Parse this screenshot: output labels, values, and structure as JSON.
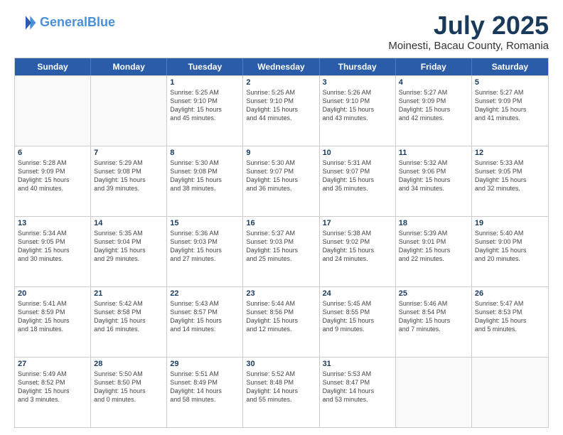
{
  "header": {
    "logo_line1": "General",
    "logo_line2": "Blue",
    "month": "July 2025",
    "location": "Moinesti, Bacau County, Romania"
  },
  "weekdays": [
    "Sunday",
    "Monday",
    "Tuesday",
    "Wednesday",
    "Thursday",
    "Friday",
    "Saturday"
  ],
  "rows": [
    [
      {
        "day": "",
        "info": ""
      },
      {
        "day": "",
        "info": ""
      },
      {
        "day": "1",
        "info": "Sunrise: 5:25 AM\nSunset: 9:10 PM\nDaylight: 15 hours\nand 45 minutes."
      },
      {
        "day": "2",
        "info": "Sunrise: 5:25 AM\nSunset: 9:10 PM\nDaylight: 15 hours\nand 44 minutes."
      },
      {
        "day": "3",
        "info": "Sunrise: 5:26 AM\nSunset: 9:10 PM\nDaylight: 15 hours\nand 43 minutes."
      },
      {
        "day": "4",
        "info": "Sunrise: 5:27 AM\nSunset: 9:09 PM\nDaylight: 15 hours\nand 42 minutes."
      },
      {
        "day": "5",
        "info": "Sunrise: 5:27 AM\nSunset: 9:09 PM\nDaylight: 15 hours\nand 41 minutes."
      }
    ],
    [
      {
        "day": "6",
        "info": "Sunrise: 5:28 AM\nSunset: 9:09 PM\nDaylight: 15 hours\nand 40 minutes."
      },
      {
        "day": "7",
        "info": "Sunrise: 5:29 AM\nSunset: 9:08 PM\nDaylight: 15 hours\nand 39 minutes."
      },
      {
        "day": "8",
        "info": "Sunrise: 5:30 AM\nSunset: 9:08 PM\nDaylight: 15 hours\nand 38 minutes."
      },
      {
        "day": "9",
        "info": "Sunrise: 5:30 AM\nSunset: 9:07 PM\nDaylight: 15 hours\nand 36 minutes."
      },
      {
        "day": "10",
        "info": "Sunrise: 5:31 AM\nSunset: 9:07 PM\nDaylight: 15 hours\nand 35 minutes."
      },
      {
        "day": "11",
        "info": "Sunrise: 5:32 AM\nSunset: 9:06 PM\nDaylight: 15 hours\nand 34 minutes."
      },
      {
        "day": "12",
        "info": "Sunrise: 5:33 AM\nSunset: 9:05 PM\nDaylight: 15 hours\nand 32 minutes."
      }
    ],
    [
      {
        "day": "13",
        "info": "Sunrise: 5:34 AM\nSunset: 9:05 PM\nDaylight: 15 hours\nand 30 minutes."
      },
      {
        "day": "14",
        "info": "Sunrise: 5:35 AM\nSunset: 9:04 PM\nDaylight: 15 hours\nand 29 minutes."
      },
      {
        "day": "15",
        "info": "Sunrise: 5:36 AM\nSunset: 9:03 PM\nDaylight: 15 hours\nand 27 minutes."
      },
      {
        "day": "16",
        "info": "Sunrise: 5:37 AM\nSunset: 9:03 PM\nDaylight: 15 hours\nand 25 minutes."
      },
      {
        "day": "17",
        "info": "Sunrise: 5:38 AM\nSunset: 9:02 PM\nDaylight: 15 hours\nand 24 minutes."
      },
      {
        "day": "18",
        "info": "Sunrise: 5:39 AM\nSunset: 9:01 PM\nDaylight: 15 hours\nand 22 minutes."
      },
      {
        "day": "19",
        "info": "Sunrise: 5:40 AM\nSunset: 9:00 PM\nDaylight: 15 hours\nand 20 minutes."
      }
    ],
    [
      {
        "day": "20",
        "info": "Sunrise: 5:41 AM\nSunset: 8:59 PM\nDaylight: 15 hours\nand 18 minutes."
      },
      {
        "day": "21",
        "info": "Sunrise: 5:42 AM\nSunset: 8:58 PM\nDaylight: 15 hours\nand 16 minutes."
      },
      {
        "day": "22",
        "info": "Sunrise: 5:43 AM\nSunset: 8:57 PM\nDaylight: 15 hours\nand 14 minutes."
      },
      {
        "day": "23",
        "info": "Sunrise: 5:44 AM\nSunset: 8:56 PM\nDaylight: 15 hours\nand 12 minutes."
      },
      {
        "day": "24",
        "info": "Sunrise: 5:45 AM\nSunset: 8:55 PM\nDaylight: 15 hours\nand 9 minutes."
      },
      {
        "day": "25",
        "info": "Sunrise: 5:46 AM\nSunset: 8:54 PM\nDaylight: 15 hours\nand 7 minutes."
      },
      {
        "day": "26",
        "info": "Sunrise: 5:47 AM\nSunset: 8:53 PM\nDaylight: 15 hours\nand 5 minutes."
      }
    ],
    [
      {
        "day": "27",
        "info": "Sunrise: 5:49 AM\nSunset: 8:52 PM\nDaylight: 15 hours\nand 3 minutes."
      },
      {
        "day": "28",
        "info": "Sunrise: 5:50 AM\nSunset: 8:50 PM\nDaylight: 15 hours\nand 0 minutes."
      },
      {
        "day": "29",
        "info": "Sunrise: 5:51 AM\nSunset: 8:49 PM\nDaylight: 14 hours\nand 58 minutes."
      },
      {
        "day": "30",
        "info": "Sunrise: 5:52 AM\nSunset: 8:48 PM\nDaylight: 14 hours\nand 55 minutes."
      },
      {
        "day": "31",
        "info": "Sunrise: 5:53 AM\nSunset: 8:47 PM\nDaylight: 14 hours\nand 53 minutes."
      },
      {
        "day": "",
        "info": ""
      },
      {
        "day": "",
        "info": ""
      }
    ]
  ]
}
